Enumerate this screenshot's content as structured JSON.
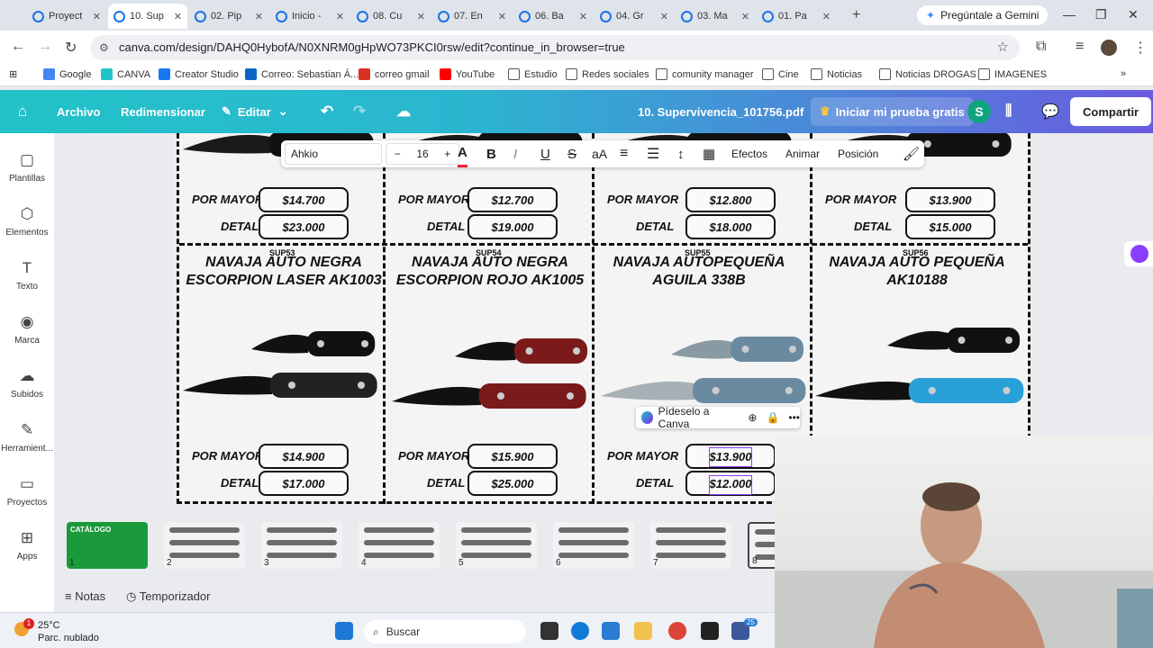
{
  "browser": {
    "tabs": [
      {
        "label": "Proyect",
        "active": false
      },
      {
        "label": "10. Sup",
        "active": true
      },
      {
        "label": "02. Pip",
        "active": false
      },
      {
        "label": "Inicio -",
        "active": false
      },
      {
        "label": "08. Cu",
        "active": false
      },
      {
        "label": "07. En",
        "active": false
      },
      {
        "label": "06. Ba",
        "active": false
      },
      {
        "label": "04. Gr",
        "active": false
      },
      {
        "label": "03. Ma",
        "active": false
      },
      {
        "label": "01. Pa",
        "active": false
      }
    ],
    "gemini_label": "Pregúntale a Gemini",
    "url": "canva.com/design/DAHQ0HybofA/N0XNRM0gHpWO73PKCI0rsw/edit?continue_in_browser=true",
    "bookmarks": [
      "Google",
      "CANVA",
      "Creator Studio",
      "Correo: Sebastian Á...",
      "correo gmail",
      "YouTube",
      "Estudio",
      "Redes sociales",
      "comunity manager",
      "Cine",
      "Noticias",
      "Noticias DROGAS",
      "IMAGENES"
    ]
  },
  "topbar": {
    "archivo": "Archivo",
    "redimensionar": "Redimensionar",
    "editar": "Editar",
    "doc_title": "10. Supervivencia_101756.pdf",
    "trial": "Iniciar mi prueba gratis",
    "avatar": "S",
    "share": "Compartir"
  },
  "sidebar": [
    "Plantillas",
    "Elementos",
    "Texto",
    "Marca",
    "Subidos",
    "Herramient...",
    "Proyectos",
    "Apps"
  ],
  "text_toolbar": {
    "font": "Ahkio",
    "size": "16",
    "items": [
      "Efectos",
      "Animar",
      "Posición"
    ]
  },
  "canvas": {
    "labels": {
      "mayor": "POR MAYOR",
      "detal": "DETAL"
    },
    "row1": [
      {
        "mayor": "$14.700",
        "detal": "$23.000"
      },
      {
        "mayor": "$12.700",
        "detal": "$19.000"
      },
      {
        "mayor": "$12.800",
        "detal": "$18.000"
      },
      {
        "mayor": "$13.900",
        "detal": "$15.000"
      }
    ],
    "row2": [
      {
        "code": "SUP53",
        "title": "NAVAJA AUTO NEGRA ESCORPION LASER AK1003",
        "mayor": "$14.900",
        "detal": "$17.000"
      },
      {
        "code": "SUP54",
        "title": "NAVAJA AUTO NEGRA ESCORPION ROJO AK1005",
        "mayor": "$15.900",
        "detal": "$25.000"
      },
      {
        "code": "SUP55",
        "title": "NAVAJA AUTOPEQUEÑA AGUILA 338B",
        "mayor": "$13.900",
        "detal": "$12.000"
      },
      {
        "code": "SUP56",
        "title": "NAVAJA AUTO PEQUEÑA AK10188",
        "mayor": "",
        "detal": ""
      }
    ]
  },
  "pideselo": "Pídeselo a Canva",
  "thumbnails": [
    "1",
    "2",
    "3",
    "4",
    "5",
    "6",
    "7",
    "8"
  ],
  "thumb1_title": "CATÁLOGO",
  "bottom": {
    "notas": "Notas",
    "temporizador": "Temporizador"
  },
  "taskbar": {
    "temp": "25°C",
    "weather": "Parc. nublado",
    "search": "Buscar",
    "badge": "1",
    "badge2": "25"
  },
  "colors": {
    "canva_teal": "#22c3c8",
    "canva_purple": "#7d2ae8",
    "selection": "#8b3dff"
  }
}
